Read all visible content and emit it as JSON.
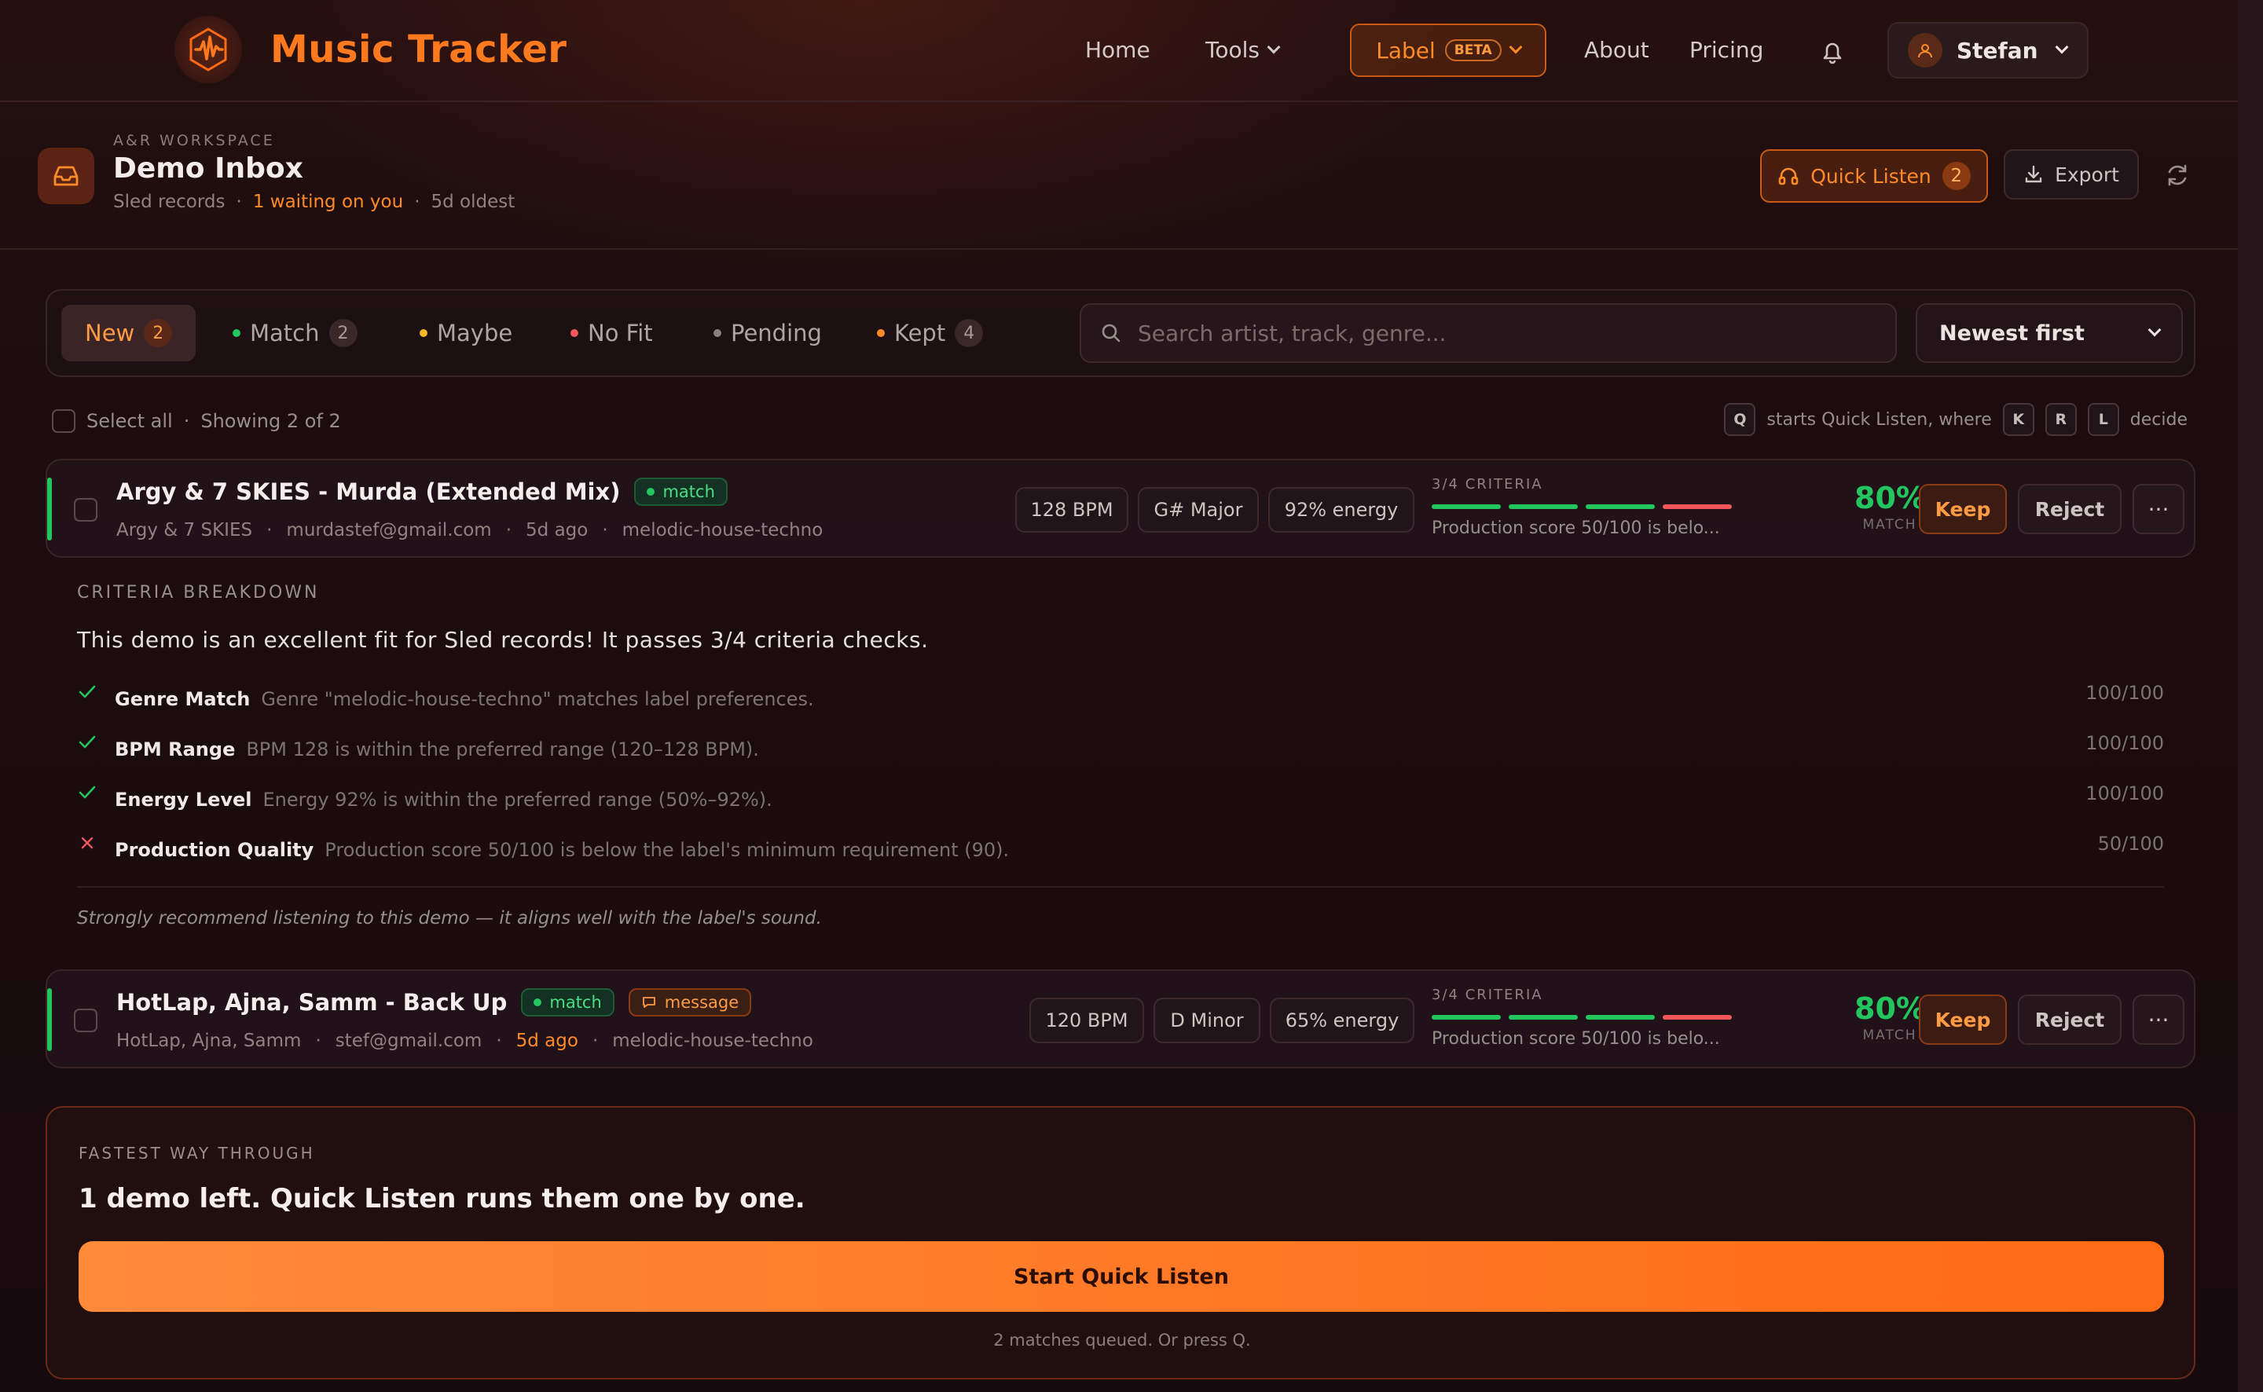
{
  "app": {
    "name": "Music Tracker",
    "accent": "#ff7a1f"
  },
  "nav": {
    "home": "Home",
    "tools": "Tools",
    "label": "Label",
    "beta": "BETA",
    "about": "About",
    "pricing": "Pricing",
    "user": "Stefan"
  },
  "header": {
    "workspace": "A&R WORKSPACE",
    "title": "Demo Inbox",
    "label_name": "Sled records",
    "waiting": "1 waiting on you",
    "oldest": "5d oldest",
    "quick_listen": "Quick Listen",
    "quick_count": "2",
    "export": "Export"
  },
  "tabs": [
    {
      "label": "New",
      "count": "2"
    },
    {
      "label": "Match",
      "count": "2",
      "dot": "#22c55e"
    },
    {
      "label": "Maybe",
      "dot": "#f5b82a"
    },
    {
      "label": "No Fit",
      "dot": "#f0565a"
    },
    {
      "label": "Pending",
      "dot": "#8a8080"
    },
    {
      "label": "Kept",
      "count": "4",
      "dot": "#ff8a2a"
    }
  ],
  "search": {
    "placeholder": "Search artist, track, genre..."
  },
  "sort": {
    "value": "Newest first"
  },
  "list": {
    "select_all": "Select all",
    "showing": "Showing 2 of 2",
    "hint_a": "starts Quick Listen, where",
    "hint_b": "decide",
    "keys": [
      "Q",
      "K",
      "R",
      "L"
    ]
  },
  "demos": [
    {
      "title": "Argy & 7 SKIES - Murda (Extended Mix)",
      "tag": "match",
      "artist": "Argy & 7 SKIES",
      "email": "murdastef@gmail.com",
      "age": "5d ago",
      "genre": "melodic-house-techno",
      "bpm": "128 BPM",
      "key": "G# Major",
      "energy": "92% energy",
      "criteria_label": "3/4 CRITERIA",
      "criteria_note": "Production score 50/100 is belo...",
      "match_pct": "80%",
      "match_label": "MATCH",
      "keep": "Keep",
      "reject": "Reject"
    },
    {
      "title": "HotLap, Ajna, Samm - Back Up",
      "tag": "match",
      "tag2": "message",
      "artist": "HotLap, Ajna, Samm",
      "email": "stef@gmail.com",
      "age": "5d ago",
      "genre": "melodic-house-techno",
      "bpm": "120 BPM",
      "key": "D Minor",
      "energy": "65% energy",
      "criteria_label": "3/4 CRITERIA",
      "criteria_note": "Production score 50/100 is belo...",
      "match_pct": "80%",
      "match_label": "MATCH",
      "keep": "Keep",
      "reject": "Reject"
    }
  ],
  "breakdown": {
    "label": "CRITERIA BREAKDOWN",
    "summary": "This demo is an excellent fit for Sled records! It passes 3/4 criteria checks.",
    "criteria": [
      {
        "name": "Genre Match",
        "desc": "Genre \"melodic-house-techno\" matches label preferences.",
        "score": "100/100",
        "pass": true
      },
      {
        "name": "BPM Range",
        "desc": "BPM 128 is within the preferred range (120–128 BPM).",
        "score": "100/100",
        "pass": true
      },
      {
        "name": "Energy Level",
        "desc": "Energy 92% is within the preferred range (50%–92%).",
        "score": "100/100",
        "pass": true
      },
      {
        "name": "Production Quality",
        "desc": "Production score 50/100 is below the label's minimum requirement (90).",
        "score": "50/100",
        "pass": false
      }
    ],
    "recommendation": "Strongly recommend listening to this demo — it aligns well with the label's sound."
  },
  "quick_card": {
    "label": "FASTEST WAY THROUGH",
    "title": "1 demo left. Quick Listen runs them one by one.",
    "button": "Start Quick Listen",
    "footer": "2 matches queued. Or press Q."
  }
}
